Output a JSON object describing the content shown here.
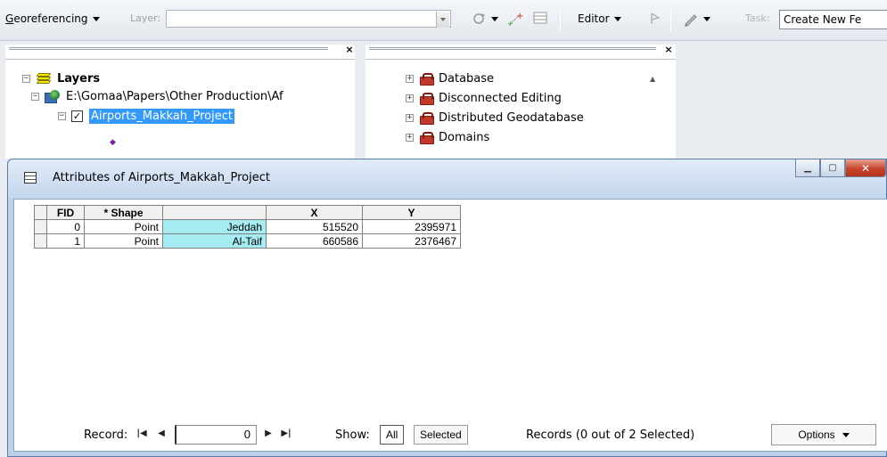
{
  "toolbar": {
    "georeferencing_label": "Georeferencing",
    "layer_label": "Layer:",
    "layer_value": "",
    "editor_label": "Editor",
    "task_label": "Task:",
    "task_value": "Create New Fe"
  },
  "toc": {
    "root_label": "Layers",
    "data_frame_label": "E:\\Gomaa\\Papers\\Other Production\\Af",
    "layer_label": "Airports_Makkah_Project",
    "layer_checked": "✓",
    "symbol": "◆"
  },
  "toolbox": {
    "items": [
      {
        "label": "Database"
      },
      {
        "label": "Disconnected Editing"
      },
      {
        "label": "Distributed Geodatabase"
      },
      {
        "label": "Domains"
      }
    ]
  },
  "attributes": {
    "title": "Attributes of Airports_Makkah_Project",
    "columns": [
      "FID",
      "* Shape",
      "",
      "X",
      "Y"
    ],
    "rows": [
      {
        "fid": "0",
        "shape": "Point",
        "name": "Jeddah",
        "x": "515520",
        "y": "2395971"
      },
      {
        "fid": "1",
        "shape": "Point",
        "name": "Al-Taif",
        "x": "660586",
        "y": "2376467"
      }
    ],
    "footer": {
      "record_label": "Record:",
      "record_value": "0",
      "show_label": "Show:",
      "all_label": "All",
      "selected_label": "Selected",
      "records_status": "Records (0 out of 2 Selected)",
      "options_label": "Options"
    }
  },
  "colors": {
    "selection": "#3399ff",
    "highlight_cell": "#a6ecf3",
    "close_button": "#c8432a"
  }
}
